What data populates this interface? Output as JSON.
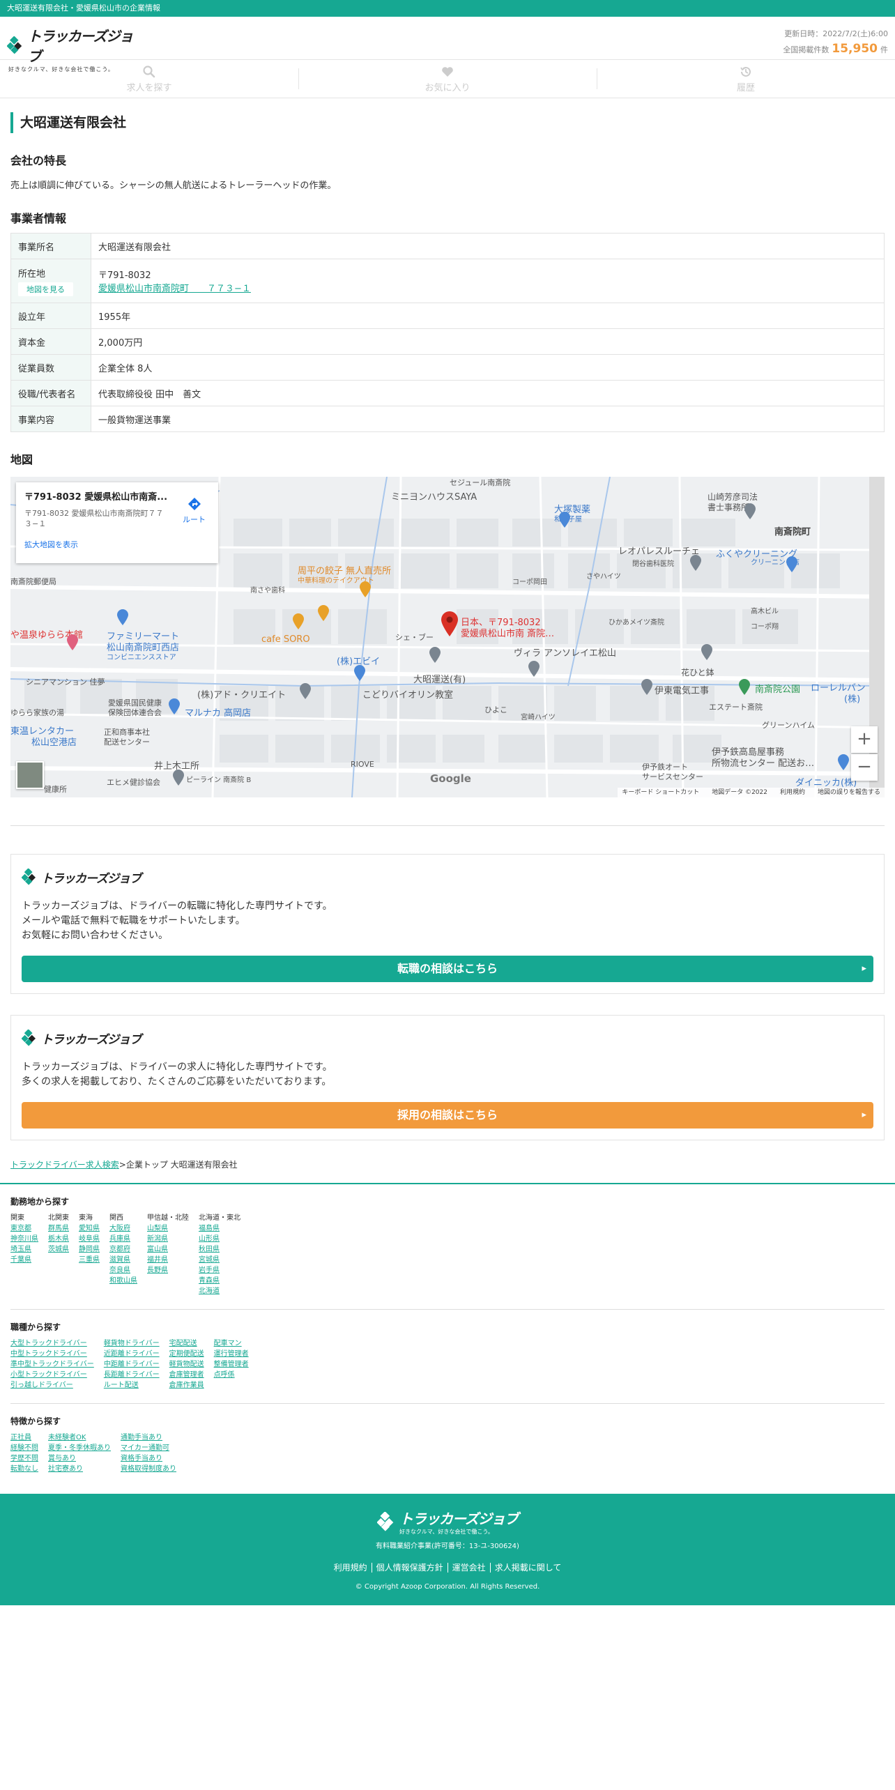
{
  "topbar": {
    "text": "大昭運送有限会社・愛媛県松山市の企業情報"
  },
  "header": {
    "logo_text": "トラッカーズジョブ",
    "logo_tagline": "好きなクルマ、好きな会社で働こう。",
    "updated": "更新日時：2022/7/2(土)6:00",
    "count_label": "全国掲載件数",
    "count_value": "15,950",
    "count_unit": "件"
  },
  "nav": {
    "tabs": [
      {
        "label": "求人を探す",
        "icon": "search-icon"
      },
      {
        "label": "お気に入り",
        "icon": "heart-icon"
      },
      {
        "label": "履歴",
        "icon": "history-icon"
      }
    ]
  },
  "company": {
    "title": "大昭運送有限会社",
    "feature_heading": "会社の特長",
    "feature_text": "売上は順調に伸びている。シャーシの無人航送によるトレーラーヘッドの作業。",
    "info_heading": "事業者情報",
    "map_button": "地図を見る",
    "rows": [
      {
        "key": "事業所名",
        "value": "大昭運送有限会社"
      },
      {
        "key": "所在地",
        "postal": "〒791-8032",
        "address": "愛媛県松山市南斎院町　　７７３−１"
      },
      {
        "key": "設立年",
        "value": "1955年"
      },
      {
        "key": "資本金",
        "value": "2,000万円"
      },
      {
        "key": "従業員数",
        "value": "企業全体 8人"
      },
      {
        "key": "役職/代表者名",
        "value": "代表取締役役 田中　善文"
      },
      {
        "key": "事業内容",
        "value": "一般貨物運送事業"
      }
    ]
  },
  "map": {
    "heading": "地図",
    "card_title": "〒791-8032 愛媛県松山市南斎...",
    "card_address": "〒791-8032 愛媛県松山市南斎院町７７３−１",
    "card_link": "拡大地図を表示",
    "route_label": "ルート",
    "pin_label_1": "日本、〒791-8032",
    "pin_label_2": "愛媛県松山市南 斎院…",
    "places": {
      "p1": "ミニヨンハウスSAYA",
      "p2": "セジュール南斎院",
      "p3": "大塚製薬",
      "p3b": "和菓子屋",
      "p4": "山崎芳彦司法",
      "p4b": "書士事務所",
      "p5": "南斎院町",
      "p6": "レオパレスルーチェ",
      "p7": "ふくやクリーニング",
      "p7b": "クリーニング店",
      "p8": "閉谷歯科医院",
      "p9": "コーポ岡田",
      "p10": "さやハイツ",
      "p11": "周平の餃子 無人直売所",
      "p11b": "中華料理のテイクアウト",
      "p12": "南さや歯科",
      "p13": "高木ビル",
      "p14": "コーポ翔",
      "p15": "ひかあメイツ斎院",
      "p16": "ファミリーマート",
      "p16b": "松山南斎院町西店",
      "p16c": "コンビニエンスストア",
      "p17": "cafe SORO",
      "p18": "シェ・ブー",
      "p19": "ヴィラ アンソレイエ松山",
      "p20": "花ひと鉢",
      "p21": "(株)エビイ",
      "p22": "こどりバイオリン教室",
      "p23": "大昭運送(有)",
      "p24": "伊東電気工事",
      "p25": "南斎院公園",
      "p26": "ローレルバン",
      "p26b": "(株)",
      "p27": "シニアマンション 佳夢",
      "p28": "(株)アド・クリエイト",
      "p29": "愛媛県国民健康",
      "p29b": "保険団体連合会",
      "p30": "マルナカ 高岡店",
      "p31": "ひよこ",
      "p32": "宮崎ハイツ",
      "p33": "エステート斎院",
      "p34": "グリーンハイム",
      "p35": "東温レンタカー",
      "p35b": "松山空港店",
      "p36": "正和商事本社",
      "p36b": "配送センター",
      "p37": "井上木工所",
      "p38": "伊予鉄高島屋事務",
      "p38b": "所物流センター 配送お…",
      "p39": "伊予鉄オート",
      "p39b": "サービスセンター",
      "p40": "ダイニッカ(株)",
      "p41": "エヒメ健診協会",
      "p42": "ピーライン 南斎院 B",
      "p43": "RIOVE",
      "p44": "や温泉ゆらら本館",
      "p45": "ゆらら家族の湯",
      "p46": "南斎院郵便局",
      "p47": "健康所"
    },
    "google": "Google",
    "footer": "キーボード ショートカット　　地図データ ©2022　　利用規約　　地図の誤りを報告する"
  },
  "promos": [
    {
      "text": [
        "トラッカーズジョブは、ドライバーの転職に特化した専門サイトです。",
        "メールや電話で無料で転職をサポートいたします。",
        "お気軽にお問い合わせください。"
      ],
      "button": "転職の相談はこちら"
    },
    {
      "text": [
        "トラッカーズジョブは、ドライバーの求人に特化した専門サイトです。",
        "多くの求人を掲載しており、たくさんのご応募をいただいております。"
      ],
      "button": "採用の相談はこちら"
    }
  ],
  "breadcrumb": {
    "link": "トラックドライバー求人検索",
    "sep": ">",
    "rest": "企業トップ 大昭運送有限会社"
  },
  "area": {
    "heading": "勤務地から探す",
    "columns": [
      {
        "head": "関東",
        "items": [
          "東京都",
          "神奈川県",
          "埼玉県",
          "千葉県"
        ]
      },
      {
        "head": "北関東",
        "items": [
          "群馬県",
          "栃木県",
          "茨城県"
        ]
      },
      {
        "head": "東海",
        "items": [
          "愛知県",
          "岐阜県",
          "静岡県",
          "三重県"
        ]
      },
      {
        "head": "関西",
        "items": [
          "大阪府",
          "兵庫県",
          "京都府",
          "滋賀県",
          "奈良県",
          "和歌山県"
        ]
      },
      {
        "head": "甲信越・北陸",
        "items": [
          "山梨県",
          "新潟県",
          "富山県",
          "福井県",
          "長野県"
        ]
      },
      {
        "head": "北海道・東北",
        "items": [
          "福島県",
          "山形県",
          "秋田県",
          "宮城県",
          "岩手県",
          "青森県",
          "北海道"
        ]
      }
    ]
  },
  "jobtype": {
    "heading": "職種から探す",
    "columns": [
      [
        "大型トラックドライバー",
        "中型トラックドライバー",
        "準中型トラックドライバー",
        "小型トラックドライバー",
        "引っ越しドライバー"
      ],
      [
        "軽貨物ドライバー",
        "近距離ドライバー",
        "中距離ドライバー",
        "長距離ドライバー",
        "ルート配送"
      ],
      [
        "宅配配送",
        "定期便配送",
        "軽貨物配送",
        "倉庫管理者",
        "倉庫作業員"
      ],
      [
        "配車マン",
        "運行管理者",
        "整備管理者",
        "点呼係"
      ]
    ]
  },
  "feature": {
    "heading": "特徴から探す",
    "columns": [
      [
        "正社員",
        "経験不問",
        "学歴不問",
        "転勤なし"
      ],
      [
        "未経験者OK",
        "夏季・冬季休暇あり",
        "賞与あり",
        "社宅寮あり"
      ],
      [
        "通勤手当あり",
        "マイカー通勤可",
        "資格手当あり",
        "資格取得制度あり"
      ]
    ]
  },
  "footer": {
    "logo_text": "トラッカーズジョブ",
    "logo_tagline": "好きなクルマ、好きな会社で働こう。",
    "license": "有料職業紹介事業(許可番号：13-ユ-300624)",
    "links": [
      "利用規約",
      "個人情報保護方針",
      "運営会社",
      "求人掲載に関して"
    ],
    "copyright": "© Copyright Azoop Corporation. All Rights Reserved."
  },
  "colors": {
    "brand": "#16a892",
    "accent": "#f29a3c",
    "map_pin": "#d93025"
  }
}
